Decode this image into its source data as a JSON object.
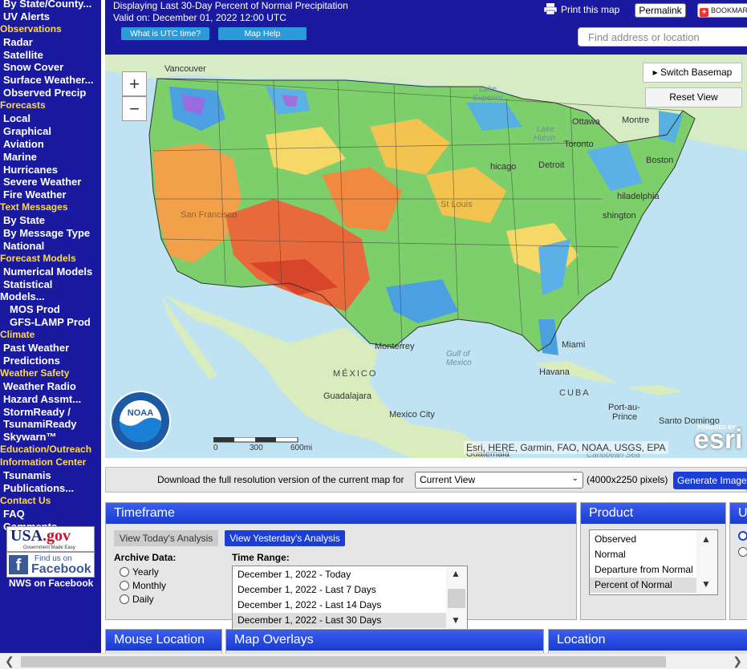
{
  "sidebar": {
    "items": [
      {
        "type": "item",
        "label": "By State/County..."
      },
      {
        "type": "item",
        "label": "UV Alerts"
      },
      {
        "type": "head",
        "label": "Observations"
      },
      {
        "type": "item",
        "label": "Radar"
      },
      {
        "type": "item",
        "label": "Satellite"
      },
      {
        "type": "item",
        "label": "Snow Cover"
      },
      {
        "type": "item",
        "label": "Surface Weather..."
      },
      {
        "type": "item",
        "label": "Observed Precip"
      },
      {
        "type": "head",
        "label": "Forecasts"
      },
      {
        "type": "item",
        "label": "Local"
      },
      {
        "type": "item",
        "label": "Graphical"
      },
      {
        "type": "item",
        "label": "Aviation"
      },
      {
        "type": "item",
        "label": "Marine"
      },
      {
        "type": "item",
        "label": "Hurricanes"
      },
      {
        "type": "item",
        "label": "Severe Weather"
      },
      {
        "type": "item",
        "label": "Fire Weather"
      },
      {
        "type": "head",
        "label": "Text Messages"
      },
      {
        "type": "item",
        "label": "By State"
      },
      {
        "type": "item",
        "label": "By Message Type"
      },
      {
        "type": "item",
        "label": "National"
      },
      {
        "type": "head",
        "label": "Forecast Models"
      },
      {
        "type": "item",
        "label": "Numerical Models"
      },
      {
        "type": "item",
        "label": "Statistical"
      },
      {
        "type": "wrap",
        "label": "Models..."
      },
      {
        "type": "sub",
        "label": "MOS Prod"
      },
      {
        "type": "sub",
        "label": "GFS-LAMP Prod"
      },
      {
        "type": "head",
        "label": "Climate"
      },
      {
        "type": "item",
        "label": "Past Weather"
      },
      {
        "type": "item",
        "label": "Predictions"
      },
      {
        "type": "head",
        "label": "Weather Safety"
      },
      {
        "type": "item",
        "label": "Weather Radio"
      },
      {
        "type": "item",
        "label": "Hazard Assmt..."
      },
      {
        "type": "item",
        "label": "StormReady /"
      },
      {
        "type": "item",
        "label": "TsunamiReady"
      },
      {
        "type": "item",
        "label": "Skywarn™"
      },
      {
        "type": "head",
        "label": "Education/Outreach"
      },
      {
        "type": "head",
        "label": "Information Center"
      },
      {
        "type": "item",
        "label": "Tsunamis"
      },
      {
        "type": "item",
        "label": "Publications..."
      },
      {
        "type": "head",
        "label": "Contact Us"
      },
      {
        "type": "item",
        "label": "FAQ"
      },
      {
        "type": "item",
        "label": "Comments..."
      }
    ],
    "usagov": {
      "text_a": "USA",
      "text_b": ".gov",
      "small": "Government Made Easy"
    },
    "facebook": {
      "find": "Find us on",
      "name": "Facebook"
    },
    "nws_on_facebook": "NWS on Facebook"
  },
  "header": {
    "title": "Displaying Last 30-Day Percent of Normal Precipitation",
    "valid": "Valid on: December 01, 2022 12:00 UTC",
    "utc_button": "What is UTC time?",
    "help_button": "Map Help",
    "print": "Print this map",
    "permalink": "Permalink",
    "bookmark": "BOOKMARK",
    "search_placeholder": "Find address or location"
  },
  "map": {
    "zoom_in": "+",
    "zoom_out": "−",
    "switch_basemap": "Switch Basemap",
    "reset_view": "Reset View",
    "attribution": "Esri, HERE, Garmin, FAO, NOAA, USGS, EPA",
    "esri_powered": "POWERED BY",
    "esri": "esri",
    "noaa": "NOAA",
    "scale": [
      "0",
      "300",
      "600mi"
    ],
    "labels": {
      "vancouver": "Vancouver",
      "lake_superior_a": "Lake",
      "lake_superior_b": "Superior",
      "lake_huron_a": "Lake",
      "lake_huron_b": "Huron",
      "ottawa": "Ottawa",
      "montreal": "Montre",
      "toronto": "Toronto",
      "chicago": "hicago",
      "detroit": "Detroit",
      "boston": "Boston",
      "philadelphia": "hiladelphia",
      "washington": "shington",
      "monterrey": "Monterrey",
      "gulf_a": "Gulf of",
      "gulf_b": "Mexico",
      "miami": "Miami",
      "havana": "Havana",
      "mexico": "MÉXICO",
      "cuba": "CUBA",
      "guadalajara": "Guadalajara",
      "mexico_city": "Mexico City",
      "port_au_prince_a": "Port-au-",
      "port_au_prince_b": "Prince",
      "santo_domingo": "Santo Domingo",
      "guatemala": "Guatemala",
      "caribbean": "Caribbean Sea",
      "san_francisco": "San Francisco",
      "st_louis": "St Louis"
    }
  },
  "download": {
    "text": "Download the full resolution version of the current map for",
    "selected": "Current View",
    "size": "(4000x2250 pixels)",
    "button": "Generate Image"
  },
  "timeframe": {
    "title": "Timeframe",
    "today": "View Today's Analysis",
    "yesterday": "View Yesterday's Analysis",
    "archive_label": "Archive Data:",
    "archive_options": [
      "Yearly",
      "Monthly",
      "Daily"
    ],
    "range_label": "Time Range:",
    "ranges": [
      "December 1, 2022 - Today",
      "December 1, 2022 - Last 7 Days",
      "December 1, 2022 - Last 14 Days",
      "December 1, 2022 - Last 30 Days"
    ],
    "selected_range_index": 3
  },
  "product": {
    "title": "Product",
    "options": [
      "Observed",
      "Normal",
      "Departure from Normal",
      "Percent of Normal"
    ],
    "selected_index": 3
  },
  "units": {
    "title": "U"
  },
  "bottom_panels": {
    "mouse_location": "Mouse Location",
    "map_overlays": "Map Overlays",
    "location": "Location"
  },
  "colors": {
    "nav_bg": "#1a1aa0",
    "nav_heading": "#ffd84a",
    "panel_title_bg": "#1a3bd0",
    "button_blue": "#2a9ad8",
    "generate_blue": "#1b3fd6"
  }
}
